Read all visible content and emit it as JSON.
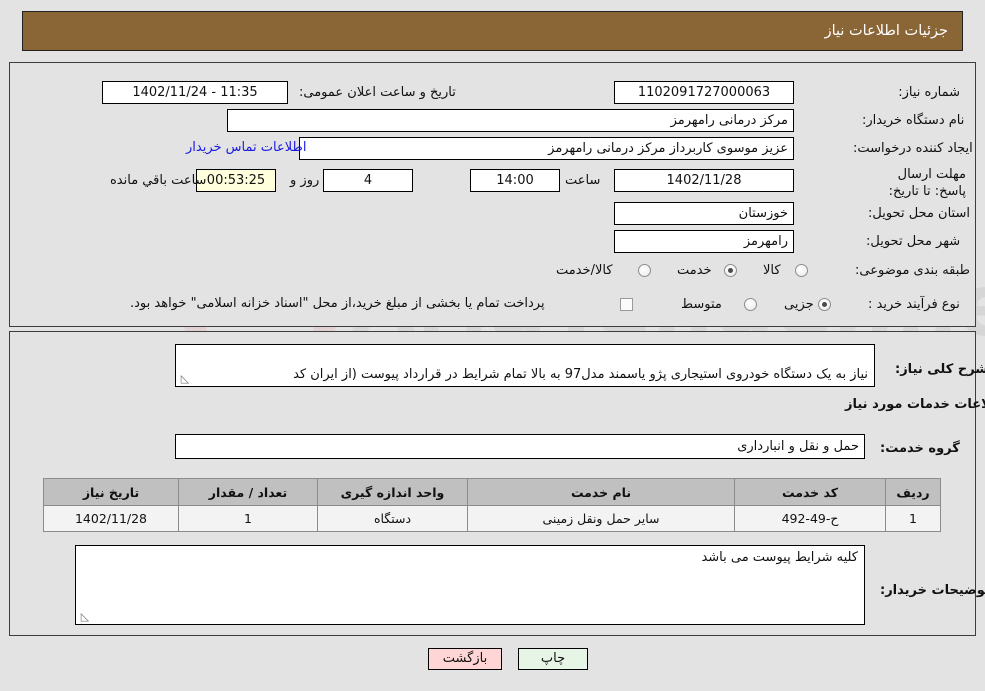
{
  "header": {
    "title": "جزئیات اطلاعات نیاز"
  },
  "fields": {
    "need_number_label": "شماره نیاز:",
    "need_number_value": "1102091727000063",
    "announce_datetime_label": "تاریخ و ساعت اعلان عمومی:",
    "announce_datetime_value": "11:35 - 1402/11/24",
    "buyer_org_label": "نام دستگاه خریدار:",
    "buyer_org_value": "مرکز درمانی رامهرمز",
    "creator_label": "ایجاد کننده درخواست:",
    "creator_value": "عزیز موسوی کاربرداز مرکز درمانی رامهرمز",
    "contact_link": "اطلاعات تماس خریدار",
    "deadline_label": "مهلت ارسال پاسخ: تا تاریخ:",
    "deadline_date": "1402/11/28",
    "hour_label": "ساعت",
    "deadline_time": "14:00",
    "days_remaining": "4",
    "days_label": "روز و",
    "countdown": "00:53:25",
    "countdown_label": "ساعت باقي مانده",
    "province_label": "استان محل تحویل:",
    "province_value": "خوزستان",
    "city_label": "شهر محل تحویل:",
    "city_value": "رامهرمز",
    "category_label": "طبقه بندی موضوعی:",
    "category_options": [
      "کالا",
      "خدمت",
      "کالا/خدمت"
    ],
    "category_selected_index": 1,
    "process_label": "نوع فرآیند خرید :",
    "process_options": [
      "جزیی",
      "متوسط"
    ],
    "process_selected_index": 0,
    "treasury_note": "پرداخت تمام یا بخشی از مبلغ خرید،از محل \"اسناد خزانه اسلامی\" خواهد بود.",
    "treasury_checked": false
  },
  "description": {
    "label": "شرح کلی نیاز:",
    "value": "نیاز به یک دستگاه خودروی استیجاری پژو یاسمند مدل97 به بالا تمام شرایط در قرارداد پیوست (از ایران کد",
    "services_heading": "اطلاعات خدمات مورد نیاز",
    "service_group_label": "گروه خدمت:",
    "service_group_value": "حمل و نقل و انبارداری"
  },
  "table": {
    "columns": [
      "ردیف",
      "کد خدمت",
      "نام خدمت",
      "واحد اندازه گیری",
      "تعداد / مقدار",
      "تاریخ نیاز"
    ],
    "rows": [
      [
        "1",
        "ح-49-492",
        "سایر حمل ونقل زمینی",
        "دستگاه",
        "1",
        "1402/11/28"
      ]
    ]
  },
  "notes": {
    "label": "توضیحات خریدار:",
    "value": "کلیه شرایط پیوست می باشد"
  },
  "buttons": {
    "print": "چاپ",
    "back": "بازگشت"
  },
  "watermark": {
    "text": "AriaTender.net"
  },
  "colors": {
    "header_bg": "#8a6637",
    "page_bg": "#e3e3e3",
    "link": "#1a1ae0",
    "print_btn": "#e6f5e6",
    "back_btn": "#ffd5d5",
    "countdown_bg": "#ffffdd",
    "table_header_bg": "#c0c0c0"
  }
}
